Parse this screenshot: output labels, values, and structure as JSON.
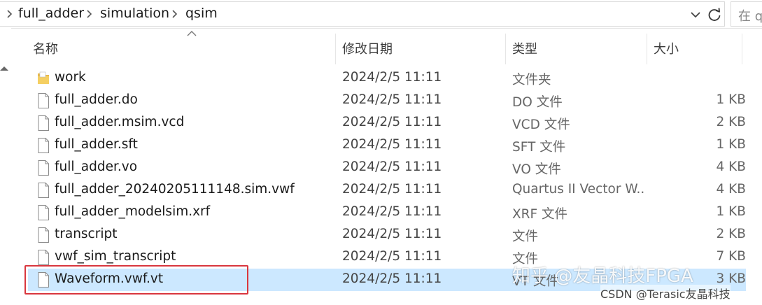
{
  "address": {
    "crumbs": [
      "full_adder",
      "simulation",
      "qsim"
    ],
    "search_placeholder": "在 q"
  },
  "columns": {
    "name": "名称",
    "date": "修改日期",
    "type": "类型",
    "size": "大小"
  },
  "files": [
    {
      "name": "work",
      "date": "2024/2/5 11:11",
      "type": "文件夹",
      "size": "",
      "icon": "folder-icon"
    },
    {
      "name": "full_adder.do",
      "date": "2024/2/5 11:11",
      "type": "DO 文件",
      "size": "1 KB",
      "icon": "file-icon"
    },
    {
      "name": "full_adder.msim.vcd",
      "date": "2024/2/5 11:11",
      "type": "VCD 文件",
      "size": "2 KB",
      "icon": "file-icon"
    },
    {
      "name": "full_adder.sft",
      "date": "2024/2/5 11:11",
      "type": "SFT 文件",
      "size": "1 KB",
      "icon": "file-icon"
    },
    {
      "name": "full_adder.vo",
      "date": "2024/2/5 11:11",
      "type": "VO 文件",
      "size": "4 KB",
      "icon": "file-icon"
    },
    {
      "name": "full_adder_20240205111148.sim.vwf",
      "date": "2024/2/5 11:11",
      "type": "Quartus II Vector W...",
      "size": "4 KB",
      "icon": "file-icon"
    },
    {
      "name": "full_adder_modelsim.xrf",
      "date": "2024/2/5 11:11",
      "type": "XRF 文件",
      "size": "1 KB",
      "icon": "file-icon"
    },
    {
      "name": "transcript",
      "date": "2024/2/5 11:11",
      "type": "文件",
      "size": "2 KB",
      "icon": "file-icon"
    },
    {
      "name": "vwf_sim_transcript",
      "date": "2024/2/5 11:11",
      "type": "文件",
      "size": "7 KB",
      "icon": "file-icon"
    },
    {
      "name": "Waveform.vwf.vt",
      "date": "2024/2/5 11:11",
      "type": "VT 文件",
      "size": "3 KB",
      "icon": "file-icon",
      "selected": true
    }
  ],
  "watermark": {
    "line1": "知乎 @友晶科技FPGA",
    "line2": "CSDN @Terasic友晶科技"
  },
  "colors": {
    "selection": "#cce8ff",
    "highlight_box": "#d9363e",
    "folder": "#e8b84a"
  }
}
